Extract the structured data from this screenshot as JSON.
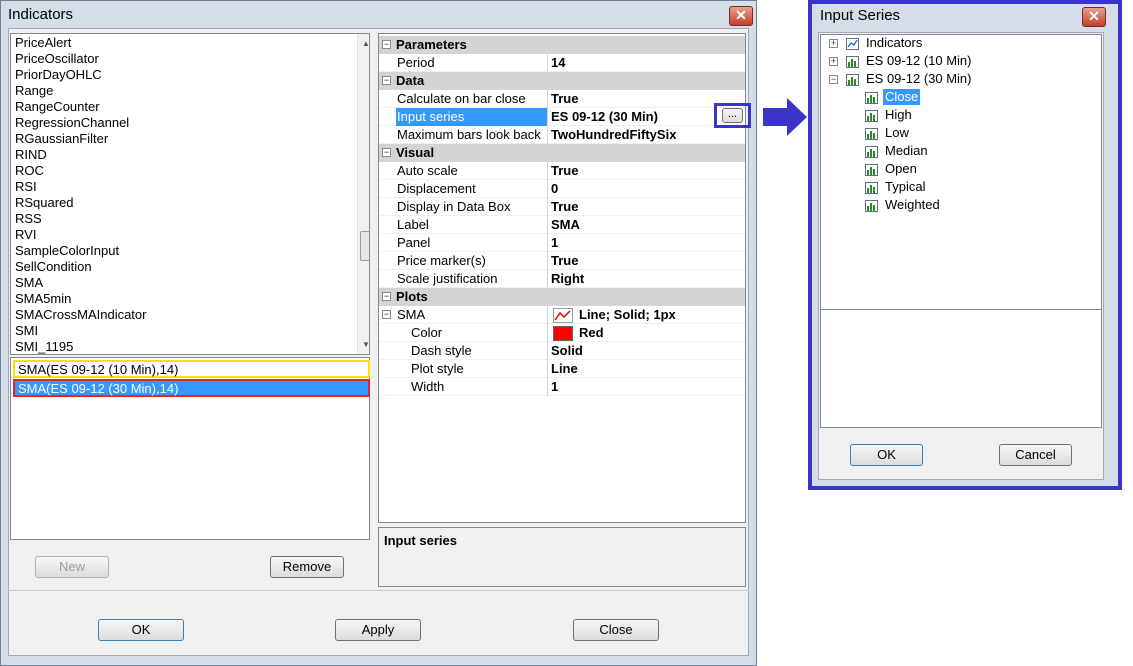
{
  "indicators_window": {
    "title": "Indicators",
    "close_glyph": "✕",
    "indicator_list": [
      "PriceAlert",
      "PriceOscillator",
      "PriorDayOHLC",
      "Range",
      "RangeCounter",
      "RegressionChannel",
      "RGaussianFilter",
      "RIND",
      "ROC",
      "RSI",
      "RSquared",
      "RSS",
      "RVI",
      "SampleColorInput",
      "SellCondition",
      "SMA",
      "SMA5min",
      "SMACrossMAIndicator",
      "SMI",
      "SMI_1195"
    ],
    "applied": [
      {
        "label": "SMA(ES 09-12 (10 Min),14)",
        "highlight": "#ffe000"
      },
      {
        "label": "SMA(ES 09-12 (30 Min),14)",
        "highlight": "#e8222a",
        "selected_bg": "#3399ff"
      }
    ],
    "properties": {
      "parameters": {
        "title": "Parameters",
        "rows": [
          {
            "name": "Period",
            "value": "14"
          }
        ]
      },
      "data": {
        "title": "Data",
        "rows": [
          {
            "name": "Calculate on bar close",
            "value": "True"
          },
          {
            "name": "Input series",
            "value": "ES 09-12 (30 Min)"
          },
          {
            "name": "Maximum bars look back",
            "value": "TwoHundredFiftySix"
          }
        ]
      },
      "visual": {
        "title": "Visual",
        "rows": [
          {
            "name": "Auto scale",
            "value": "True"
          },
          {
            "name": "Displacement",
            "value": "0"
          },
          {
            "name": "Display in Data Box",
            "value": "True"
          },
          {
            "name": "Label",
            "value": "SMA"
          },
          {
            "name": "Panel",
            "value": "1"
          },
          {
            "name": "Price marker(s)",
            "value": "True"
          },
          {
            "name": "Scale justification",
            "value": "Right"
          }
        ]
      },
      "plots": {
        "title": "Plots",
        "rows": [
          {
            "name": "SMA",
            "value": "Line; Solid; 1px"
          },
          {
            "name": "Color",
            "value": "Red",
            "swatch": "#ff0000"
          },
          {
            "name": "Dash style",
            "value": "Solid"
          },
          {
            "name": "Plot style",
            "value": "Line"
          },
          {
            "name": "Width",
            "value": "1"
          }
        ]
      },
      "ellipsis_label": "...",
      "ellipsis_highlight": "#3a35c8"
    },
    "help_title": "Input series",
    "buttons": {
      "new": "New",
      "remove": "Remove",
      "ok": "OK",
      "apply": "Apply",
      "close": "Close"
    }
  },
  "input_series_window": {
    "title": "Input Series",
    "close_glyph": "✕",
    "tree": [
      {
        "label": "Indicators",
        "expander": "+"
      },
      {
        "label": "ES 09-12 (10 Min)",
        "expander": "+"
      },
      {
        "label": "ES 09-12 (30 Min)",
        "expander": "−",
        "children": [
          "Close",
          "High",
          "Low",
          "Median",
          "Open",
          "Typical",
          "Weighted"
        ]
      }
    ],
    "selected_child": "Close",
    "buttons": {
      "ok": "OK",
      "cancel": "Cancel"
    },
    "border_color": "#3a35c8"
  }
}
